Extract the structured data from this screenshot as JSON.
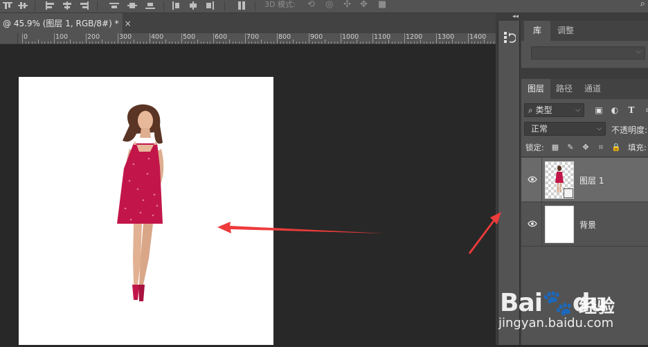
{
  "options_bar": {
    "mode_3d_label": "3D 模式:"
  },
  "document": {
    "tab_title": "@ 45.9% (图层 1, RGB/8#) *",
    "close_glyph": "×"
  },
  "ruler": {
    "labels": [
      "0",
      "100",
      "200",
      "300",
      "400",
      "500",
      "600",
      "700",
      "800",
      "900",
      "1000",
      "1100",
      "1200",
      "1300",
      "1400"
    ]
  },
  "panels": {
    "collapse_glyph": "◂◂",
    "library": {
      "tabs": [
        "库",
        "调整"
      ],
      "active_tab": "库"
    },
    "layers": {
      "tabs": [
        "图层",
        "路径",
        "通道"
      ],
      "active_tab": "图层",
      "filter_kind": "类型",
      "blend_mode": "正常",
      "opacity_label": "不透明度:",
      "lock_label": "锁定:",
      "fill_label": "填充:",
      "items": [
        {
          "name": "图层 1",
          "selected": true,
          "visible": true
        },
        {
          "name": "背景",
          "selected": false,
          "visible": true
        }
      ]
    }
  },
  "watermark": {
    "logo": "Bai",
    "logo2": "du",
    "chinese": "经验",
    "url": "jingyan.baidu.com"
  },
  "colors": {
    "annotation_arrow": "#ee3b3b",
    "dress": "#c2164a"
  },
  "icons": {
    "eye": "eye-icon",
    "search": "search-icon",
    "history": "history-icon"
  }
}
